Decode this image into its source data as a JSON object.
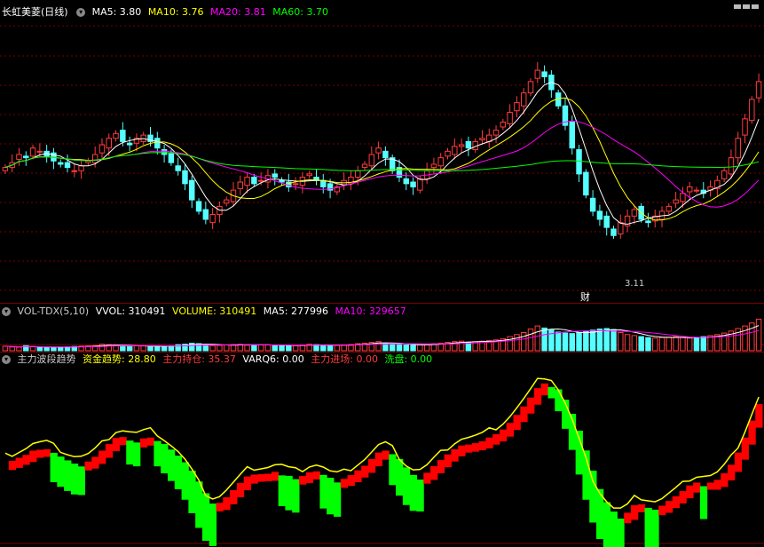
{
  "main_panel": {
    "title": "长虹美菱",
    "period": "(日线)",
    "ma5_label": "MA5: 3.80",
    "ma10_label": "MA10: 3.76",
    "ma20_label": "MA20: 3.81",
    "ma60_label": "MA60: 3.70",
    "low_marker": "3.11",
    "event_marker": "财"
  },
  "volume_panel": {
    "name": "VOL-TDX(5,10)",
    "vvol_label": "VVOL: 310491",
    "volume_label": "VOLUME: 310491",
    "ma5_label": "MA5: 277996",
    "ma10_label": "MA10: 329657"
  },
  "indicator_panel": {
    "name": "主力波段趋势",
    "fund_trend_label": "资金趋势: 28.80",
    "main_hold_label": "主力持仓: 35.37",
    "varq6_label": "VARQ6: 0.00",
    "main_entry_label": "主力进场: 0.00",
    "wash_label": "洗盘: 0.00"
  },
  "colors": {
    "up": "#ff3c3c",
    "down": "#54ffff",
    "ma5": "#ffffff",
    "ma10": "#ffff00",
    "ma20": "#ff00ff",
    "ma60": "#00ff00",
    "hold_up": "#ff0000",
    "hold_down": "#00ff00",
    "trend": "#ffff00",
    "grid": "#7a0000"
  },
  "chart_data": [
    {
      "type": "candlestick",
      "title": "长虹美菱 (日线)",
      "series_names": [
        "MA5",
        "MA10",
        "MA20",
        "MA60"
      ],
      "last_values": {
        "MA5": 3.8,
        "MA10": 3.76,
        "MA20": 3.81,
        "MA60": 3.7
      },
      "annotated_low": 3.11,
      "y_approx_range": [
        3.0,
        4.6
      ],
      "closes": [
        3.72,
        3.75,
        3.8,
        3.78,
        3.84,
        3.82,
        3.79,
        3.76,
        3.74,
        3.72,
        3.7,
        3.73,
        3.76,
        3.8,
        3.86,
        3.9,
        3.93,
        3.88,
        3.86,
        3.9,
        3.92,
        3.88,
        3.84,
        3.8,
        3.75,
        3.7,
        3.62,
        3.52,
        3.45,
        3.4,
        3.43,
        3.48,
        3.52,
        3.58,
        3.63,
        3.66,
        3.62,
        3.64,
        3.67,
        3.66,
        3.63,
        3.6,
        3.62,
        3.66,
        3.68,
        3.64,
        3.6,
        3.58,
        3.6,
        3.64,
        3.66,
        3.7,
        3.74,
        3.8,
        3.84,
        3.78,
        3.7,
        3.66,
        3.62,
        3.6,
        3.65,
        3.7,
        3.74,
        3.78,
        3.82,
        3.85,
        3.86,
        3.84,
        3.88,
        3.9,
        3.92,
        3.95,
        4.0,
        4.06,
        4.12,
        4.18,
        4.25,
        4.32,
        4.28,
        4.2,
        4.1,
        3.98,
        3.84,
        3.68,
        3.55,
        3.45,
        3.4,
        3.35,
        3.3,
        3.38,
        3.42,
        3.46,
        3.4,
        3.38,
        3.42,
        3.45,
        3.48,
        3.52,
        3.56,
        3.6,
        3.58,
        3.56,
        3.6,
        3.64,
        3.7,
        3.78,
        3.9,
        4.02,
        4.14,
        4.25
      ]
    },
    {
      "type": "bar",
      "title": "VOL-TDX(5,10)",
      "series_names": [
        "VOLUME",
        "MA5",
        "MA10"
      ],
      "last_values": {
        "VVOL": 310491,
        "VOLUME": 310491,
        "MA5": 277996,
        "MA10": 329657
      },
      "volumes": [
        180,
        150,
        140,
        200,
        160,
        130,
        120,
        140,
        150,
        160,
        170,
        180,
        190,
        200,
        260,
        240,
        220,
        180,
        170,
        200,
        190,
        170,
        160,
        180,
        200,
        240,
        260,
        300,
        280,
        220,
        200,
        210,
        230,
        250,
        260,
        220,
        210,
        230,
        240,
        220,
        200,
        190,
        200,
        230,
        260,
        240,
        220,
        200,
        210,
        230,
        250,
        280,
        300,
        330,
        360,
        300,
        260,
        240,
        230,
        220,
        240,
        260,
        280,
        300,
        330,
        360,
        380,
        340,
        360,
        380,
        400,
        430,
        480,
        560,
        640,
        720,
        860,
        980,
        900,
        820,
        740,
        700,
        680,
        720,
        760,
        820,
        860,
        880,
        840,
        720,
        640,
        600,
        560,
        520,
        500,
        520,
        540,
        560,
        520,
        500,
        520,
        560,
        600,
        640,
        700,
        780,
        880,
        980,
        1100,
        1250
      ]
    },
    {
      "type": "bar",
      "title": "主力波段趋势",
      "series_names": [
        "资金趋势",
        "主力持仓",
        "VARQ6",
        "主力进场",
        "洗盘"
      ],
      "last_values": {
        "资金趋势": 28.8,
        "主力持仓": 35.37,
        "VARQ6": 0.0,
        "主力进场": 0.0,
        "洗盘": 0.0
      }
    }
  ]
}
